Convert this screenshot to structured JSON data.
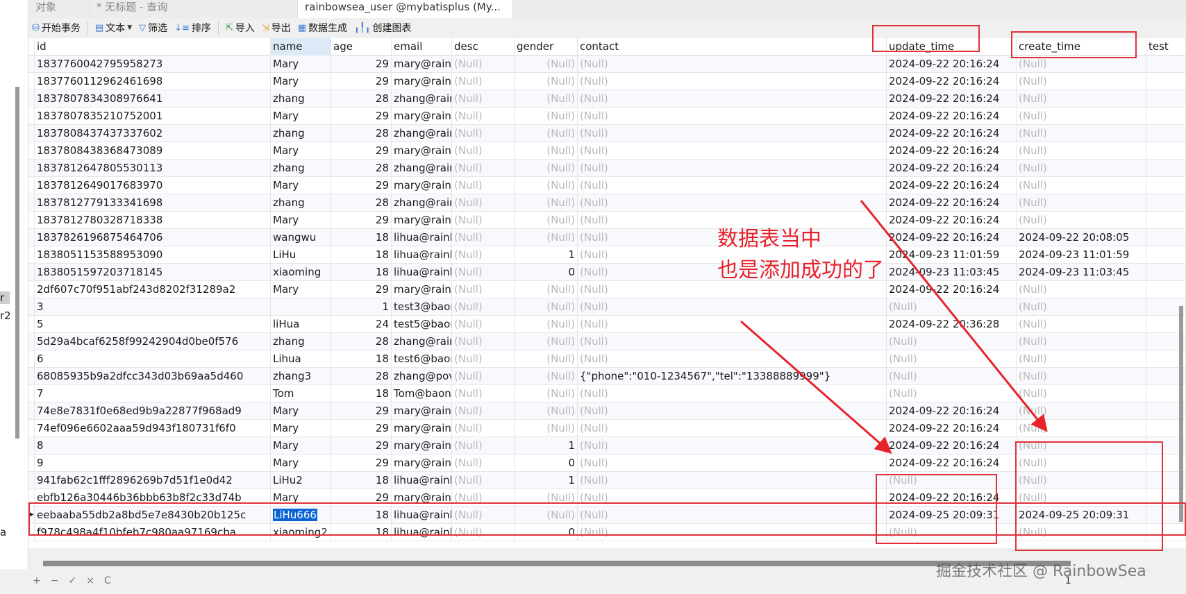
{
  "tabs": [
    {
      "label": "对象"
    },
    {
      "label": "* 无标题 - 查询"
    },
    {
      "label": "rainbowsea_user @mybatisplus (My..."
    }
  ],
  "toolbar": {
    "begin": "开始事务",
    "text": "文本",
    "filter": "筛选",
    "sort": "排序",
    "import": "导入",
    "export": "导出",
    "gen": "数据生成",
    "chart": "创建图表"
  },
  "sidebar": [
    "r",
    "r2",
    "a"
  ],
  "columns": [
    "id",
    "name",
    "age",
    "email",
    "desc",
    "gender",
    "contact",
    "update_time",
    "create_time",
    "test"
  ],
  "rows": [
    [
      "1837760042795958273",
      "Mary",
      "29",
      "mary@rainb",
      "(Null)",
      "(Null)",
      "(Null)",
      "2024-09-22 20:16:24",
      "(Null)"
    ],
    [
      "1837760112962461698",
      "Mary",
      "29",
      "mary@rainb",
      "(Null)",
      "(Null)",
      "(Null)",
      "2024-09-22 20:16:24",
      "(Null)"
    ],
    [
      "1837807834308976641",
      "zhang",
      "28",
      "zhang@rain",
      "(Null)",
      "(Null)",
      "(Null)",
      "2024-09-22 20:16:24",
      "(Null)"
    ],
    [
      "1837807835210752001",
      "Mary",
      "29",
      "mary@rainb",
      "(Null)",
      "(Null)",
      "(Null)",
      "2024-09-22 20:16:24",
      "(Null)"
    ],
    [
      "1837808437437337602",
      "zhang",
      "28",
      "zhang@rain",
      "(Null)",
      "(Null)",
      "(Null)",
      "2024-09-22 20:16:24",
      "(Null)"
    ],
    [
      "1837808438368473089",
      "Mary",
      "29",
      "mary@rainb",
      "(Null)",
      "(Null)",
      "(Null)",
      "2024-09-22 20:16:24",
      "(Null)"
    ],
    [
      "1837812647805530113",
      "zhang",
      "28",
      "zhang@rain",
      "(Null)",
      "(Null)",
      "(Null)",
      "2024-09-22 20:16:24",
      "(Null)"
    ],
    [
      "1837812649017683970",
      "Mary",
      "29",
      "mary@rainb",
      "(Null)",
      "(Null)",
      "(Null)",
      "2024-09-22 20:16:24",
      "(Null)"
    ],
    [
      "1837812779133341698",
      "zhang",
      "28",
      "zhang@rain",
      "(Null)",
      "(Null)",
      "(Null)",
      "2024-09-22 20:16:24",
      "(Null)"
    ],
    [
      "1837812780328718338",
      "Mary",
      "29",
      "mary@rainb",
      "(Null)",
      "(Null)",
      "(Null)",
      "2024-09-22 20:16:24",
      "(Null)"
    ],
    [
      "1837826196875464706",
      "wangwu",
      "18",
      "lihua@rainb",
      "(Null)",
      "(Null)",
      "(Null)",
      "2024-09-22 20:16:24",
      "2024-09-22 20:08:05"
    ],
    [
      "1838051153588953090",
      "LiHu",
      "18",
      "lihua@rainb",
      "(Null)",
      "1",
      "(Null)",
      "2024-09-23 11:01:59",
      "2024-09-23 11:01:59"
    ],
    [
      "1838051597203718145",
      "xiaoming",
      "18",
      "lihua@rainb",
      "(Null)",
      "0",
      "(Null)",
      "2024-09-23 11:03:45",
      "2024-09-23 11:03:45"
    ],
    [
      "2df607c70f951abf243d8202f31289a2",
      "Mary",
      "29",
      "mary@rainb",
      "(Null)",
      "(Null)",
      "(Null)",
      "2024-09-22 20:16:24",
      "(Null)"
    ],
    [
      "3",
      "",
      "1",
      "test3@baor",
      "(Null)",
      "(Null)",
      "(Null)",
      "(Null)",
      "(Null)"
    ],
    [
      "5",
      "liHua",
      "24",
      "test5@baor",
      "(Null)",
      "(Null)",
      "(Null)",
      "2024-09-22 20:36:28",
      "(Null)"
    ],
    [
      "5d29a4bcaf6258f99242904d0be0f576",
      "zhang",
      "28",
      "zhang@rain",
      "(Null)",
      "(Null)",
      "(Null)",
      "(Null)",
      "(Null)"
    ],
    [
      "6",
      "Lihua",
      "18",
      "test6@baor",
      "(Null)",
      "(Null)",
      "(Null)",
      "(Null)",
      "(Null)"
    ],
    [
      "68085935b9a2dfcc343d03b69aa5d460",
      "zhang3",
      "28",
      "zhang@pov",
      "(Null)",
      "(Null)",
      "{\"phone\":\"010-1234567\",\"tel\":\"13388889999\"}",
      "(Null)",
      "(Null)"
    ],
    [
      "7",
      "Tom",
      "18",
      "Tom@baon",
      "(Null)",
      "(Null)",
      "(Null)",
      "(Null)",
      "(Null)"
    ],
    [
      "74e8e7831f0e68ed9b9a22877f968ad9",
      "Mary",
      "29",
      "mary@rainb",
      "(Null)",
      "(Null)",
      "(Null)",
      "2024-09-22 20:16:24",
      "(Null)"
    ],
    [
      "74ef096e6602aaa59d943f180731f6f0",
      "Mary",
      "29",
      "mary@rainb",
      "(Null)",
      "(Null)",
      "(Null)",
      "2024-09-22 20:16:24",
      "(Null)"
    ],
    [
      "8",
      "Mary",
      "29",
      "mary@rainb",
      "(Null)",
      "1",
      "(Null)",
      "2024-09-22 20:16:24",
      "(Null)"
    ],
    [
      "9",
      "Mary",
      "29",
      "mary@rainb",
      "(Null)",
      "0",
      "(Null)",
      "2024-09-22 20:16:24",
      "(Null)"
    ],
    [
      "941fab62c1fff2896269b7d51f1e0d42",
      "LiHu2",
      "18",
      "lihua@rainb",
      "(Null)",
      "1",
      "(Null)",
      "(Null)",
      "(Null)"
    ],
    [
      "ebfb126a30446b36bbb63b8f2c33d74b",
      "Mary",
      "29",
      "mary@rainb",
      "(Null)",
      "(Null)",
      "(Null)",
      "2024-09-22 20:16:24",
      "(Null)"
    ],
    [
      "eebaaba55db2a8bd5e7e8430b20b125c",
      "LiHu666",
      "18",
      "lihua@rainb",
      "(Null)",
      "(Null)",
      "(Null)",
      "2024-09-25 20:09:31",
      "2024-09-25 20:09:31"
    ],
    [
      "f978c498a4f10bfeb7c980aa97169cba",
      "xiaoming2",
      "18",
      "lihua@rainb",
      "(Null)",
      "0",
      "(Null)",
      "(Null)",
      "(Null)"
    ]
  ],
  "selected_row": 26,
  "annotation": {
    "line1": "数据表当中",
    "line2": "也是添加成功的了",
    "color": "#e8222a"
  },
  "watermark": "掘金技术社区 @ RainbowSea",
  "bottom": {
    "add": "+",
    "remove": "−",
    "apply": "✓",
    "discard": "×",
    "refresh": "C",
    "page": "1"
  }
}
